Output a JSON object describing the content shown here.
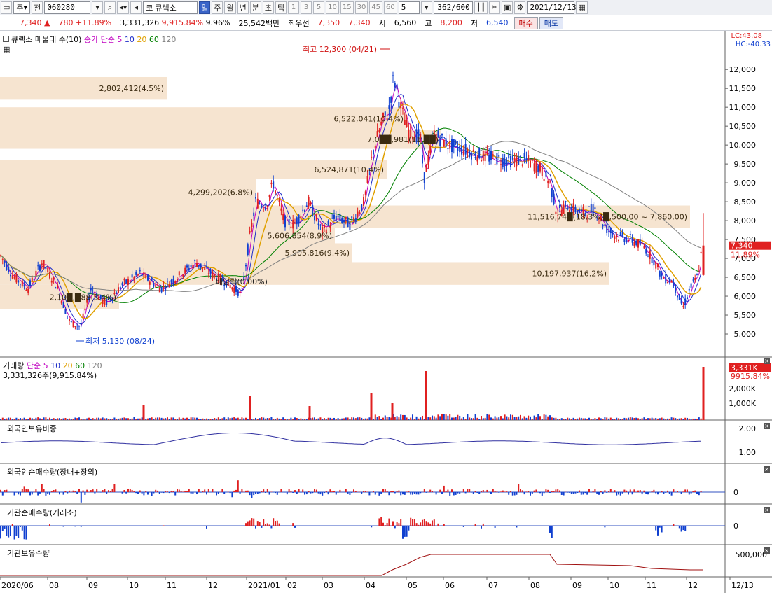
{
  "toolbar": {
    "market": "주",
    "prev": "전",
    "code": "060280",
    "exchange_badge": "코",
    "stock_name": "큐렉소",
    "periods": [
      "일",
      "주",
      "월",
      "년",
      "분",
      "초",
      "틱"
    ],
    "active_period": "일",
    "intervals": [
      "1",
      "3",
      "5",
      "10",
      "15",
      "30",
      "45",
      "60"
    ],
    "interval_value": "5",
    "count": "362/600",
    "date": "2021/12/13"
  },
  "quote": {
    "price": "7,340",
    "change": "780",
    "change_pct": "+11.89%",
    "volume": "3,331,326",
    "vol_ratio": "9,915.84%",
    "turnover": "9.96%",
    "amount": "25,542백만",
    "best_ask_label": "최우선",
    "best_ask": "7,350",
    "best_bid": "7,340",
    "open_label": "시",
    "open": "6,560",
    "high_label": "고",
    "high": "8,200",
    "low_label": "저",
    "low": "6,540",
    "buy": "매수",
    "sell": "매도"
  },
  "price_pane": {
    "legend_name": "큐렉소 매물대 수(10)",
    "ma_label": "종가 단순",
    "ma_periods": [
      "5",
      "10",
      "20",
      "60",
      "120"
    ],
    "ma_colors": [
      "#c000c0",
      "#1c2cc8",
      "#e0a000",
      "#008000",
      "#808080"
    ],
    "lc": "LC:43.08",
    "hc": "HC:-40.33",
    "high_marker": "최고 12,300 (04/21)",
    "low_marker": "최저 5,130 (08/24)",
    "dividend": "배당락(0.00%)",
    "current_price": "7,340",
    "current_pct": "11.89%",
    "y_ticks": [
      "12,000",
      "11,500",
      "11,000",
      "10,500",
      "10,000",
      "9,500",
      "9,000",
      "8,500",
      "8,000",
      "7,500",
      "7,000",
      "6,500",
      "6,000",
      "5,500",
      "5,000"
    ],
    "volume_profile": [
      {
        "label": "2,802,412(4.5%)"
      },
      {
        "label": "6,522,041(10.4%)"
      },
      {
        "label": "7,0██,981(11.██)"
      },
      {
        "label": "6,524,871(10.4%)"
      },
      {
        "label": "4,299,202(6.8%)"
      },
      {
        "label": "11,516,74█(18.3%)█,500.00 ~ 7,860.00)"
      },
      {
        "label": "5,606,854(8.9%)"
      },
      {
        "label": "5,905,816(9.4%)"
      },
      {
        "label": "10,197,937(16.2%)"
      },
      {
        "label": "2,10█,█88(3.4%)"
      }
    ]
  },
  "volume_pane": {
    "title": "거래량",
    "ma_label": "단순",
    "ma_periods": [
      "5",
      "10",
      "20",
      "60",
      "120"
    ],
    "summary": "3,331,326주(9,915.84%)",
    "current": "3,331K",
    "current_pct": "9915.84%",
    "y_ticks": [
      "2,000K",
      "1,000K"
    ]
  },
  "foreign_hold_pane": {
    "title": "외국인보유비중",
    "y_ticks": [
      "2.00",
      "1.00"
    ]
  },
  "foreign_net_pane": {
    "title": "외국인순매수량(장내+장외)",
    "zero": "0"
  },
  "inst_net_pane": {
    "title": "기관순매수량(거래소)",
    "zero": "0"
  },
  "inst_hold_pane": {
    "title": "기관보유수량",
    "y_ticks": [
      "500,000"
    ]
  },
  "x_axis": {
    "labels": [
      "2020/06",
      "08",
      "09",
      "10",
      "11",
      "12",
      "2021/01",
      "02",
      "03",
      "04",
      "05",
      "06",
      "07",
      "08",
      "09",
      "10",
      "11",
      "12",
      "12/13"
    ]
  },
  "colors": {
    "up": "#e02020",
    "down": "#1040d0",
    "profile": "#f4dfc8",
    "grid": "#d8dce4"
  }
}
